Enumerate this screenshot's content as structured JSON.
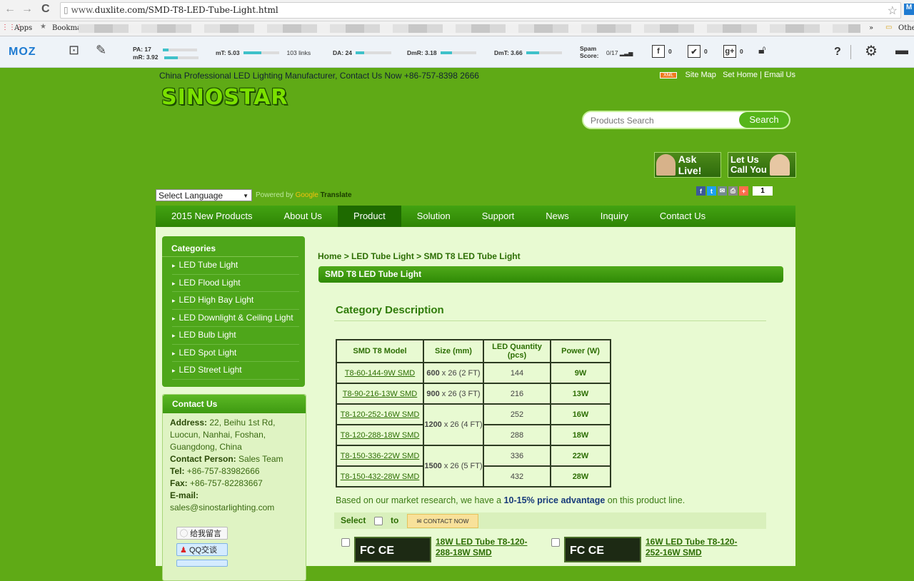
{
  "browser": {
    "url_scheme": "www.",
    "url_rest": "duxlite.com/SMD-T8-LED-Tube-Light.html",
    "apps_label": "Apps",
    "bookmarks_label": "Bookmar",
    "other_label": "Othe",
    "overflow_label": "»"
  },
  "moz": {
    "logo": "MOZ",
    "pa": "PA: 17",
    "mr": "mR: 3.92",
    "mt": "mT: 5.03",
    "links": "103 links",
    "da": "DA: 24",
    "dmr": "DmR: 3.18",
    "dmt": "DmT: 3.66",
    "spam_label": "Spam Score:",
    "spam_value": "0/17",
    "fb_count": "0",
    "tw_count": "0",
    "gp_count": "0",
    "help": "?",
    "bars": {
      "pa": 0.17,
      "mr": 0.39,
      "mt": 0.5,
      "da": 0.24,
      "dmr": 0.32,
      "dmt": 0.37
    }
  },
  "header": {
    "tagline": "China Professional LED Lighting Manufacturer, Contact Us Now +86-757-8398 2666",
    "xml": "XML",
    "site_map": "Site Map",
    "set_home": "Set Home |",
    "email_us": "Email Us",
    "logo": "SINOSTAR",
    "search_placeholder": "Products Search",
    "search_button": "Search",
    "ask_live": "Ask Live!",
    "call_you_1": "Let Us",
    "call_you_2": "Call You",
    "select_language": "Select Language",
    "powered_by": "Powered by",
    "google": "Google",
    "translate": "Translate",
    "share_count": "1"
  },
  "nav": [
    "2015 New Products",
    "About Us",
    "Product",
    "Solution",
    "Support",
    "News",
    "Inquiry",
    "Contact Us"
  ],
  "categories": {
    "title": "Categories",
    "items": [
      "LED Tube Light",
      "LED Flood Light",
      "LED High Bay Light",
      "LED Downlight & Ceiling Light",
      "LED Bulb Light",
      "LED Spot Light",
      "LED Street Light"
    ]
  },
  "contact": {
    "title": "Contact Us",
    "address_label": "Address:",
    "address": "22, Beihu 1st Rd, Luocun, Nanhai, Foshan, Guangdong, China",
    "person_label": "Contact Person:",
    "person": "Sales Team",
    "tel_label": "Tel:",
    "tel": "+86-757-83982666",
    "fax_label": "Fax:",
    "fax": "+86-757-82283667",
    "email_label": "E-mail:",
    "email": "sales@sinostarlighting.com",
    "btn_message": "给我留言",
    "btn_qq": "QQ交谈"
  },
  "breadcrumb": {
    "home": "Home",
    "level1": "LED Tube Light",
    "level2": "SMD T8 LED Tube Light",
    "sep": ">"
  },
  "page_title": "SMD T8 LED Tube Light",
  "category_description": "Category Description",
  "table": {
    "headers": [
      "SMD T8 Model",
      "Size  (mm)",
      "LED Quantity (pcs)",
      "Power  (W)"
    ],
    "rows": [
      {
        "model": "T8-60-144-9W SMD",
        "size_bold": "600",
        "size_rest": " x 26 (2 FT)",
        "qty": "144",
        "power": "9W"
      },
      {
        "model": "T8-90-216-13W SMD",
        "size_bold": "900",
        "size_rest": " x 26 (3 FT)",
        "qty": "216",
        "power": "13W"
      },
      {
        "model": "T8-120-252-16W SMD",
        "size_bold": "1200",
        "size_rest": " x 26 (4 FT)",
        "qty": "252",
        "power": "16W"
      },
      {
        "model": "T8-120-288-18W SMD",
        "size_bold": "",
        "size_rest": "",
        "qty": "288",
        "power": "18W"
      },
      {
        "model": "T8-150-336-22W SMD",
        "size_bold": "1500",
        "size_rest": " x 26 (5 FT)",
        "qty": "336",
        "power": "22W"
      },
      {
        "model": "T8-150-432-28W SMD",
        "size_bold": "",
        "size_rest": "",
        "qty": "432",
        "power": "28W"
      }
    ]
  },
  "advantage": {
    "pre": "Based on our market research, we have a ",
    "bold": "10-15% price advantage",
    "post": " on this product line."
  },
  "select_bar": {
    "select": "Select",
    "to": "to",
    "contact_now": "CONTACT NOW"
  },
  "products": [
    {
      "title": "18W LED Tube T8-120-288-18W SMD",
      "badge": "FC CE"
    },
    {
      "title": "16W LED Tube T8-120-252-16W SMD",
      "badge": "FC CE"
    }
  ]
}
